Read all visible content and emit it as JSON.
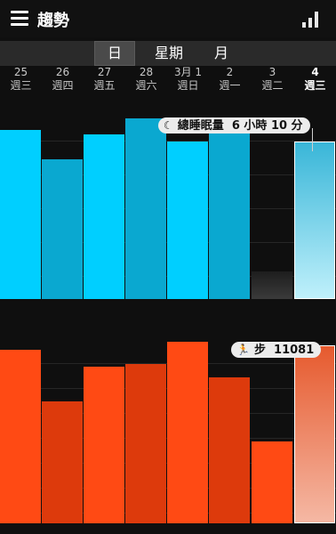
{
  "app": {
    "title": "趨勢"
  },
  "tabs": [
    {
      "label": "日",
      "active": true
    },
    {
      "label": "星期",
      "active": false
    },
    {
      "label": "月",
      "active": false
    }
  ],
  "days": [
    {
      "date": "25",
      "weekday": "週三",
      "today": false
    },
    {
      "date": "26",
      "weekday": "週四",
      "today": false
    },
    {
      "date": "27",
      "weekday": "週五",
      "today": false
    },
    {
      "date": "28",
      "weekday": "週六",
      "today": false
    },
    {
      "date": "3月 1",
      "weekday": "週日",
      "today": false
    },
    {
      "date": "2",
      "weekday": "週一",
      "today": false
    },
    {
      "date": "3",
      "weekday": "週二",
      "today": false
    },
    {
      "date": "4",
      "weekday": "週三",
      "today": true
    }
  ],
  "sleep": {
    "label": "總睡眠量",
    "value": "6 小時 10 分",
    "icon": "moon-icon",
    "levels": [
      0.87,
      0.72,
      0.85,
      0.93,
      0.81,
      0.91,
      0.14,
      0.81
    ],
    "colors": {
      "bright": "#00cfff",
      "dark": "#0aa8d0",
      "today_top": "#39b6d8",
      "today_bottom": "#bff0fb",
      "empty": "#3a3a3a"
    }
  },
  "steps": {
    "label": "步",
    "value": "11081",
    "icon": "runner-icon",
    "levels": [
      0.93,
      0.65,
      0.84,
      0.85,
      0.97,
      0.78,
      0.44,
      0.95
    ],
    "colors": {
      "bright": "#ff4a14",
      "dark": "#dd3a0c",
      "today_top": "#e65a2e",
      "today_bottom": "#f5b8a4"
    }
  }
}
